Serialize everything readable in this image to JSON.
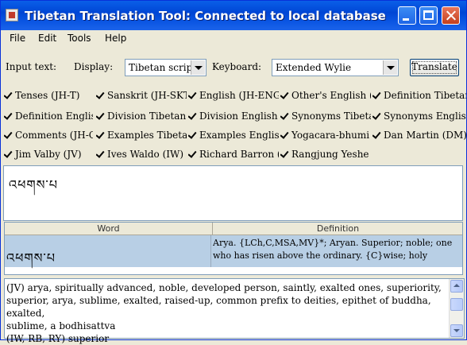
{
  "window": {
    "title": "Tibetan Translation Tool: Connected to local database"
  },
  "menu": [
    "File",
    "Edit",
    "Tools",
    "Help"
  ],
  "controls": {
    "input_label": "Input text:",
    "display_label": "Display:",
    "display_value": "Tibetan script",
    "keyboard_label": "Keyboard:",
    "keyboard_value": "Extended Wylie",
    "translate_label": "Translate"
  },
  "dictionaries": [
    [
      "Tenses (JH-T)",
      "Sanskrit (JH-SKT",
      "English (JH-ENG)",
      "Other's English (J",
      "Definition Tibetan"
    ],
    [
      "Definition English",
      "Division Tibetan (",
      "Division English (",
      "Synonyms Tibeta",
      "Synonyms English"
    ],
    [
      "Comments (JH-C",
      "Examples Tibetan",
      "Examples English",
      "Yogacara-bhumi (",
      "Dan Martin (DM)"
    ],
    [
      "Jim Valby (JV)",
      "Ives Waldo (IW)",
      "Richard Barron (R",
      "Rangjung Yeshe ("
    ]
  ],
  "input_text": "འཕགས་པ",
  "results": {
    "headers": {
      "word": "Word",
      "definition": "Definition"
    },
    "row": {
      "word": "འཕགས་པ",
      "def_line1": "Arya. {LCh,C,MSA,MV}*; Aryan. Superior; noble; one",
      "def_line2": "who has risen above the ordinary. {C}wise; holy"
    }
  },
  "details": {
    "line1": "(JV) arya, spiritually advanced, noble, developed person, saintly, exalted ones, superiority,",
    "line2": "superior, arya, sublime, exalted, raised-up, common prefix to deities, epithet of buddha, exalted,",
    "line3": "sublime, a bodhisattva",
    "line4": "(IW, RB, RY) superior"
  }
}
